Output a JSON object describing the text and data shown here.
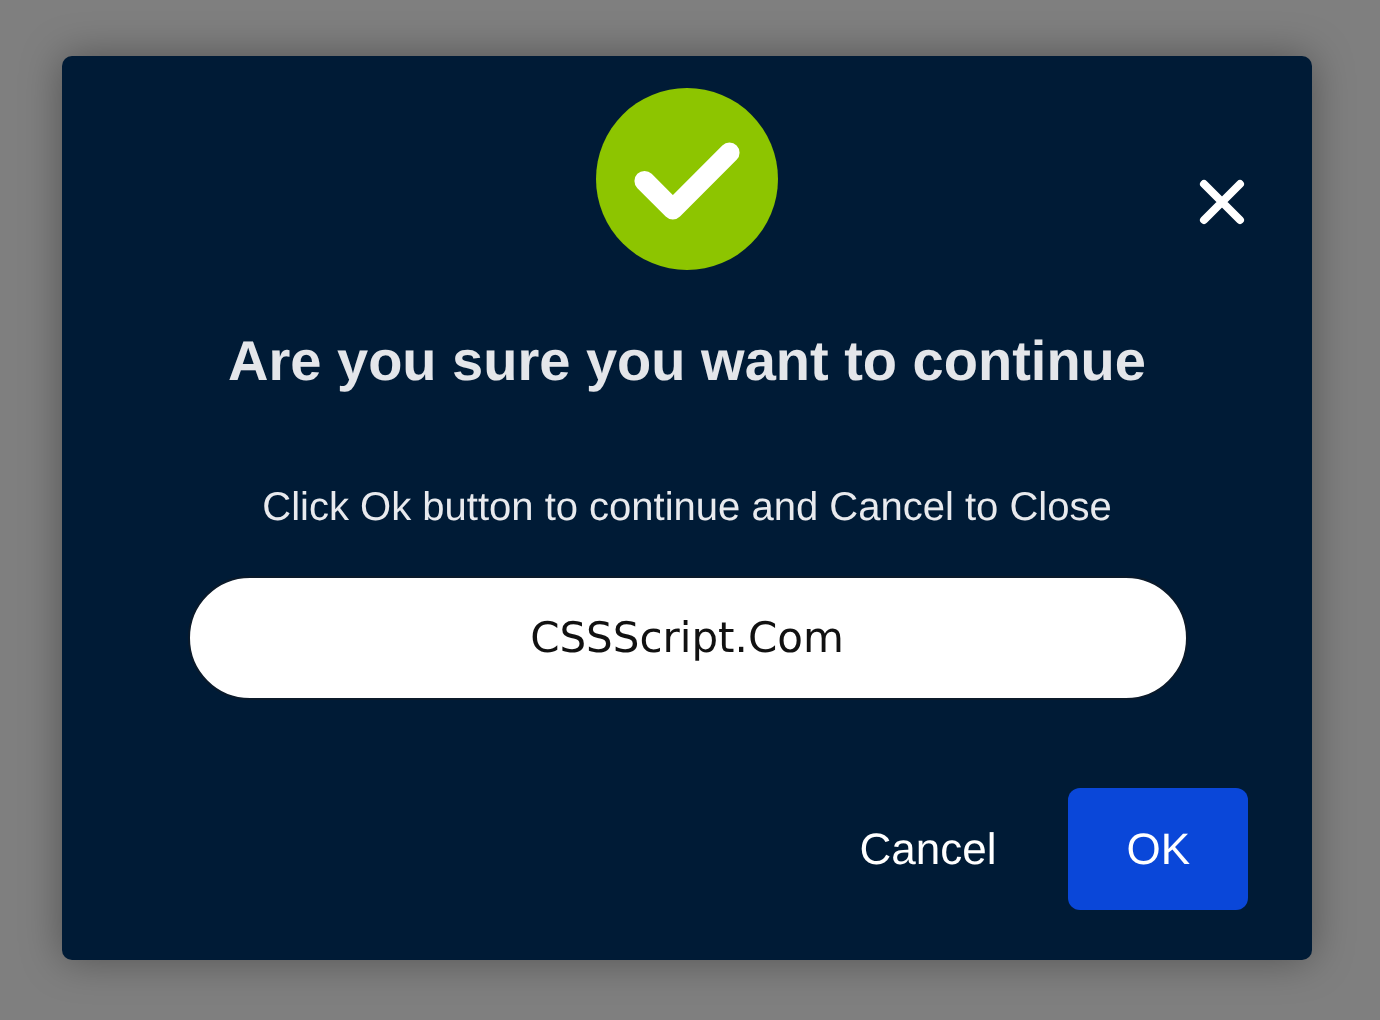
{
  "dialog": {
    "title": "Are you sure you want to continue",
    "message": "Click Ok button to continue and Cancel to Close",
    "input": {
      "value": "CSSScript.Com"
    },
    "buttons": [
      {
        "label": "Cancel",
        "kind": "text"
      },
      {
        "label": "OK",
        "kind": "primary"
      }
    ]
  }
}
